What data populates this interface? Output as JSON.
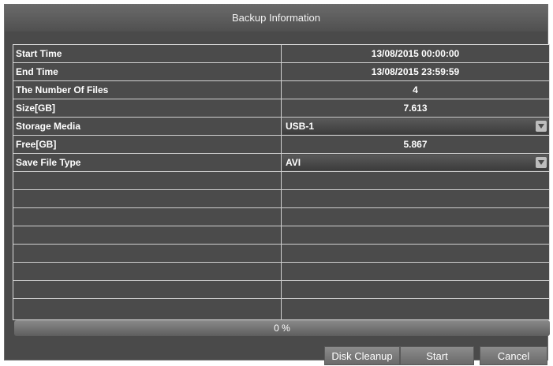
{
  "dialog": {
    "title": "Backup Information"
  },
  "rows": [
    {
      "label": "Start Time",
      "value": "13/08/2015 00:00:00"
    },
    {
      "label": "End Time",
      "value": "13/08/2015 23:59:59"
    },
    {
      "label": "The Number Of Files",
      "value": "4"
    },
    {
      "label": "Size[GB]",
      "value": "7.613"
    },
    {
      "label": "Storage Media",
      "value": "USB-1"
    },
    {
      "label": "Free[GB]",
      "value": "5.867"
    },
    {
      "label": "Save File Type",
      "value": "AVI"
    }
  ],
  "progress": {
    "label": "0 %",
    "percent": 0
  },
  "buttons": {
    "disk_cleanup": "Disk Cleanup",
    "start": "Start",
    "cancel": "Cancel"
  },
  "icons": {
    "dropdown": "chevron-down-icon"
  },
  "colors": {
    "panel": "#4a4a4a",
    "grid_line": "#d0d0d0",
    "text": "#ffffff"
  }
}
